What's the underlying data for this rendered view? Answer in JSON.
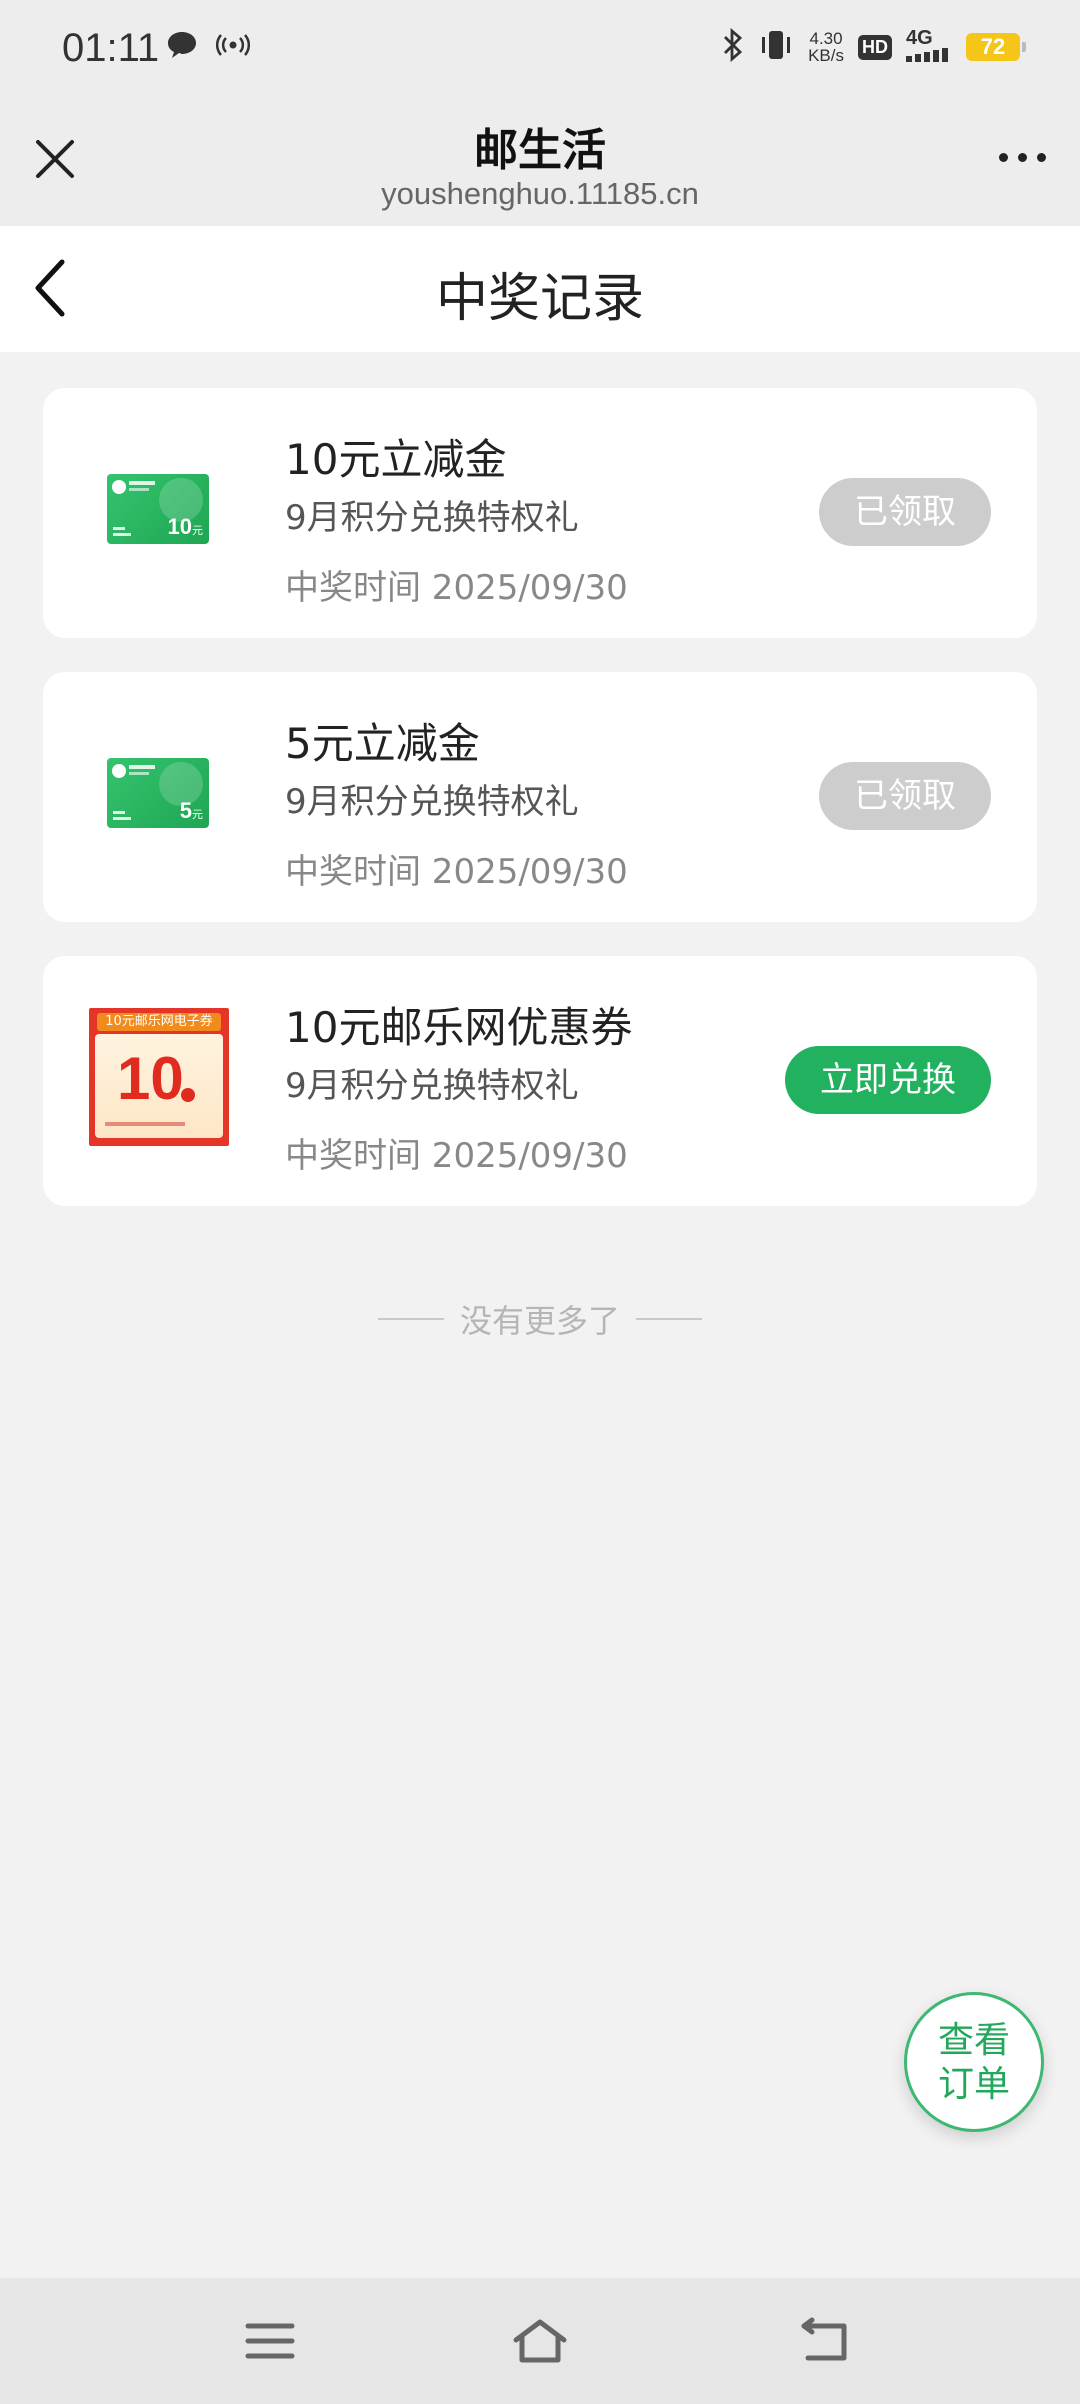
{
  "status_bar": {
    "time": "01:11",
    "speed_value": "4.30",
    "speed_unit": "KB/s",
    "hd": "HD",
    "network": "4G",
    "battery": "72",
    "icons": [
      "message-icon",
      "broadcast-icon",
      "bluetooth-icon",
      "vibrate-icon",
      "signal-icon"
    ]
  },
  "browser": {
    "title": "邮生活",
    "url": "youshenghuo.11185.cn",
    "close_icon": "close-icon",
    "more_icon": "more-icon"
  },
  "page": {
    "title": "中奖记录",
    "back_icon": "back-icon"
  },
  "records": [
    {
      "title": "10元立减金",
      "subtitle": "9月积分兑换特权礼",
      "time": "中奖时间 2025/09/30",
      "button": "已领取",
      "button_state": "claimed",
      "thumb_amount": "10",
      "thumb_unit": "元"
    },
    {
      "title": "5元立减金",
      "subtitle": "9月积分兑换特权礼",
      "time": "中奖时间 2025/09/30",
      "button": "已领取",
      "button_state": "claimed",
      "thumb_amount": "5",
      "thumb_unit": "元"
    },
    {
      "title": "10元邮乐网优惠券",
      "subtitle": "9月积分兑换特权礼",
      "time": "中奖时间 2025/09/30",
      "button": "立即兑换",
      "button_state": "redeem",
      "thumb_label": "10元邮乐网电子券",
      "thumb_amount": "10"
    }
  ],
  "no_more": "没有更多了",
  "fab": {
    "line1": "查看",
    "line2": "订单"
  },
  "colors": {
    "accent": "#22b25f",
    "disabled": "#cdcdcd",
    "background": "#f2f2f2"
  },
  "nav": {
    "icons": [
      "menu-icon",
      "home-icon",
      "back-nav-icon"
    ]
  }
}
